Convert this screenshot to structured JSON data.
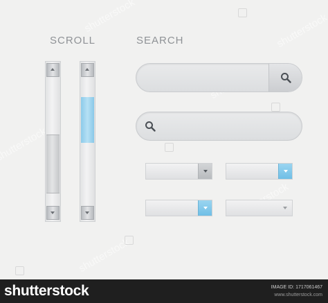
{
  "headings": {
    "scroll": "SCROLL",
    "search": "SEARCH"
  },
  "scrollbars": [
    {
      "thumb_style": "grey",
      "thumb_position": 0.62,
      "thumb_size": 0.41
    },
    {
      "thumb_style": "blue",
      "thumb_position": 0.0,
      "thumb_size": 0.32
    }
  ],
  "search_boxes": [
    {
      "value": "",
      "icon": "magnifier-icon",
      "icon_side": "right-button"
    },
    {
      "value": "",
      "icon": "magnifier-icon",
      "icon_side": "left"
    }
  ],
  "dropdowns": [
    {
      "value": "",
      "arrow_style": "grey"
    },
    {
      "value": "",
      "arrow_style": "blue"
    },
    {
      "value": "",
      "arrow_style": "blue"
    },
    {
      "value": "",
      "arrow_style": "flat"
    }
  ],
  "watermark": {
    "text": "shutterstock"
  },
  "footer": {
    "brand": "shutterstock",
    "image_id": "IMAGE ID: 1717061467",
    "site": "www.shutterstock.com"
  },
  "colors": {
    "accent_blue": "#86c7e8",
    "background": "#f1f1f0",
    "footer_bg": "#1f1f1f"
  }
}
